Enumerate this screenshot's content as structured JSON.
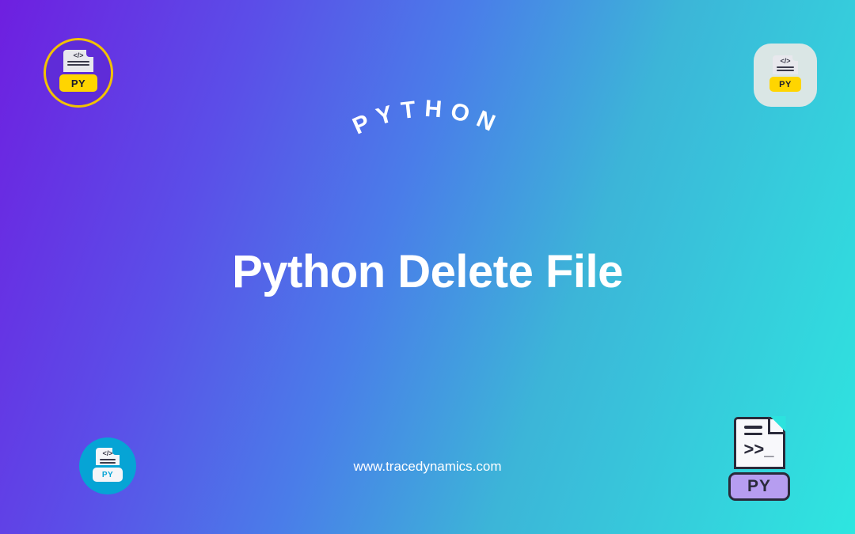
{
  "curved_label": "PYTHON",
  "main_title": "Python Delete File",
  "website": "www.tracedynamics.com",
  "icons": {
    "py_label": "PY",
    "prompt": ">>_"
  }
}
